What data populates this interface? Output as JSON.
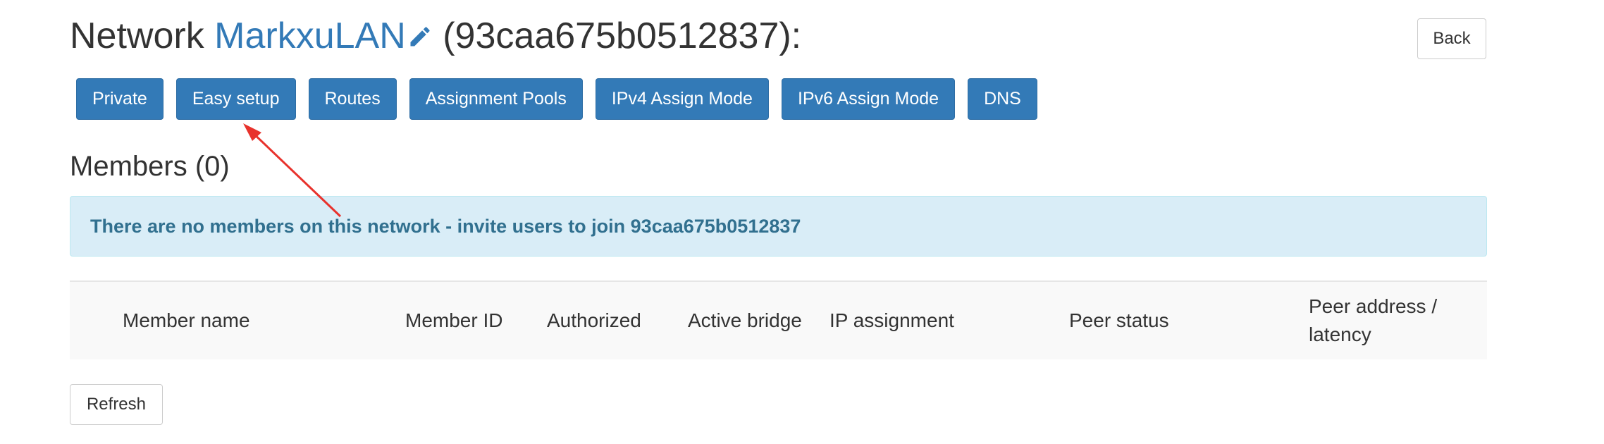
{
  "header": {
    "prefix": "Network ",
    "network_name": "MarkxuLAN",
    "network_id_text": " (93caa675b0512837):",
    "back_label": "Back"
  },
  "toolbar": {
    "buttons": [
      {
        "label": "Private"
      },
      {
        "label": "Easy setup"
      },
      {
        "label": "Routes"
      },
      {
        "label": "Assignment Pools"
      },
      {
        "label": "IPv4 Assign Mode"
      },
      {
        "label": "IPv6 Assign Mode"
      },
      {
        "label": "DNS"
      }
    ]
  },
  "members": {
    "heading": "Members (0)",
    "empty_notice": "There are no members on this network - invite users to join 93caa675b0512837",
    "columns": [
      "Member name",
      "Member ID",
      "Authorized",
      "Active bridge",
      "IP assignment",
      "Peer status",
      "Peer address /",
      "latency"
    ],
    "refresh_label": "Refresh"
  },
  "icons": {
    "edit": "pencil-icon"
  },
  "colors": {
    "primary": "#337ab7",
    "alert_bg": "#d9edf7",
    "alert_text": "#31708f",
    "annotation_arrow": "#e8322c"
  }
}
